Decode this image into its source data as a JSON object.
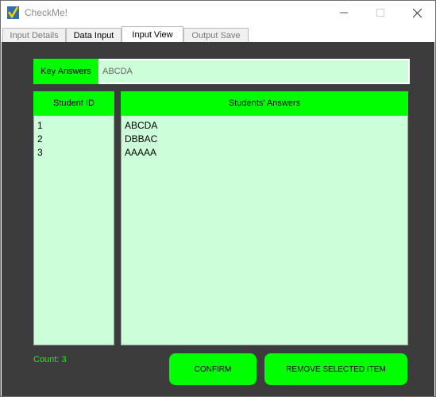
{
  "window": {
    "title": "CheckMe!",
    "icon": "checkmark-app-icon"
  },
  "tabs": [
    {
      "label": "Input Details",
      "active": false
    },
    {
      "label": "Data Input",
      "active": false
    },
    {
      "label": "Input View",
      "active": true
    },
    {
      "label": "Output Save",
      "active": false
    }
  ],
  "key_answers": {
    "label": "Key Answers",
    "value": "ABCDA"
  },
  "table": {
    "id_header": "Student ID",
    "answers_header": "Students' Answers",
    "rows": [
      {
        "id": "1",
        "answers": "ABCDA"
      },
      {
        "id": "2",
        "answers": "DBBAC"
      },
      {
        "id": "3",
        "answers": "AAAAA"
      }
    ]
  },
  "footer": {
    "count_label": "Count: 3",
    "confirm_label": "CONFIRM",
    "remove_label": "REMOVE SELECTED ITEM"
  },
  "colors": {
    "accent": "#00ff00",
    "list_bg": "#ccffd9",
    "content_bg": "#3c3c3c"
  }
}
